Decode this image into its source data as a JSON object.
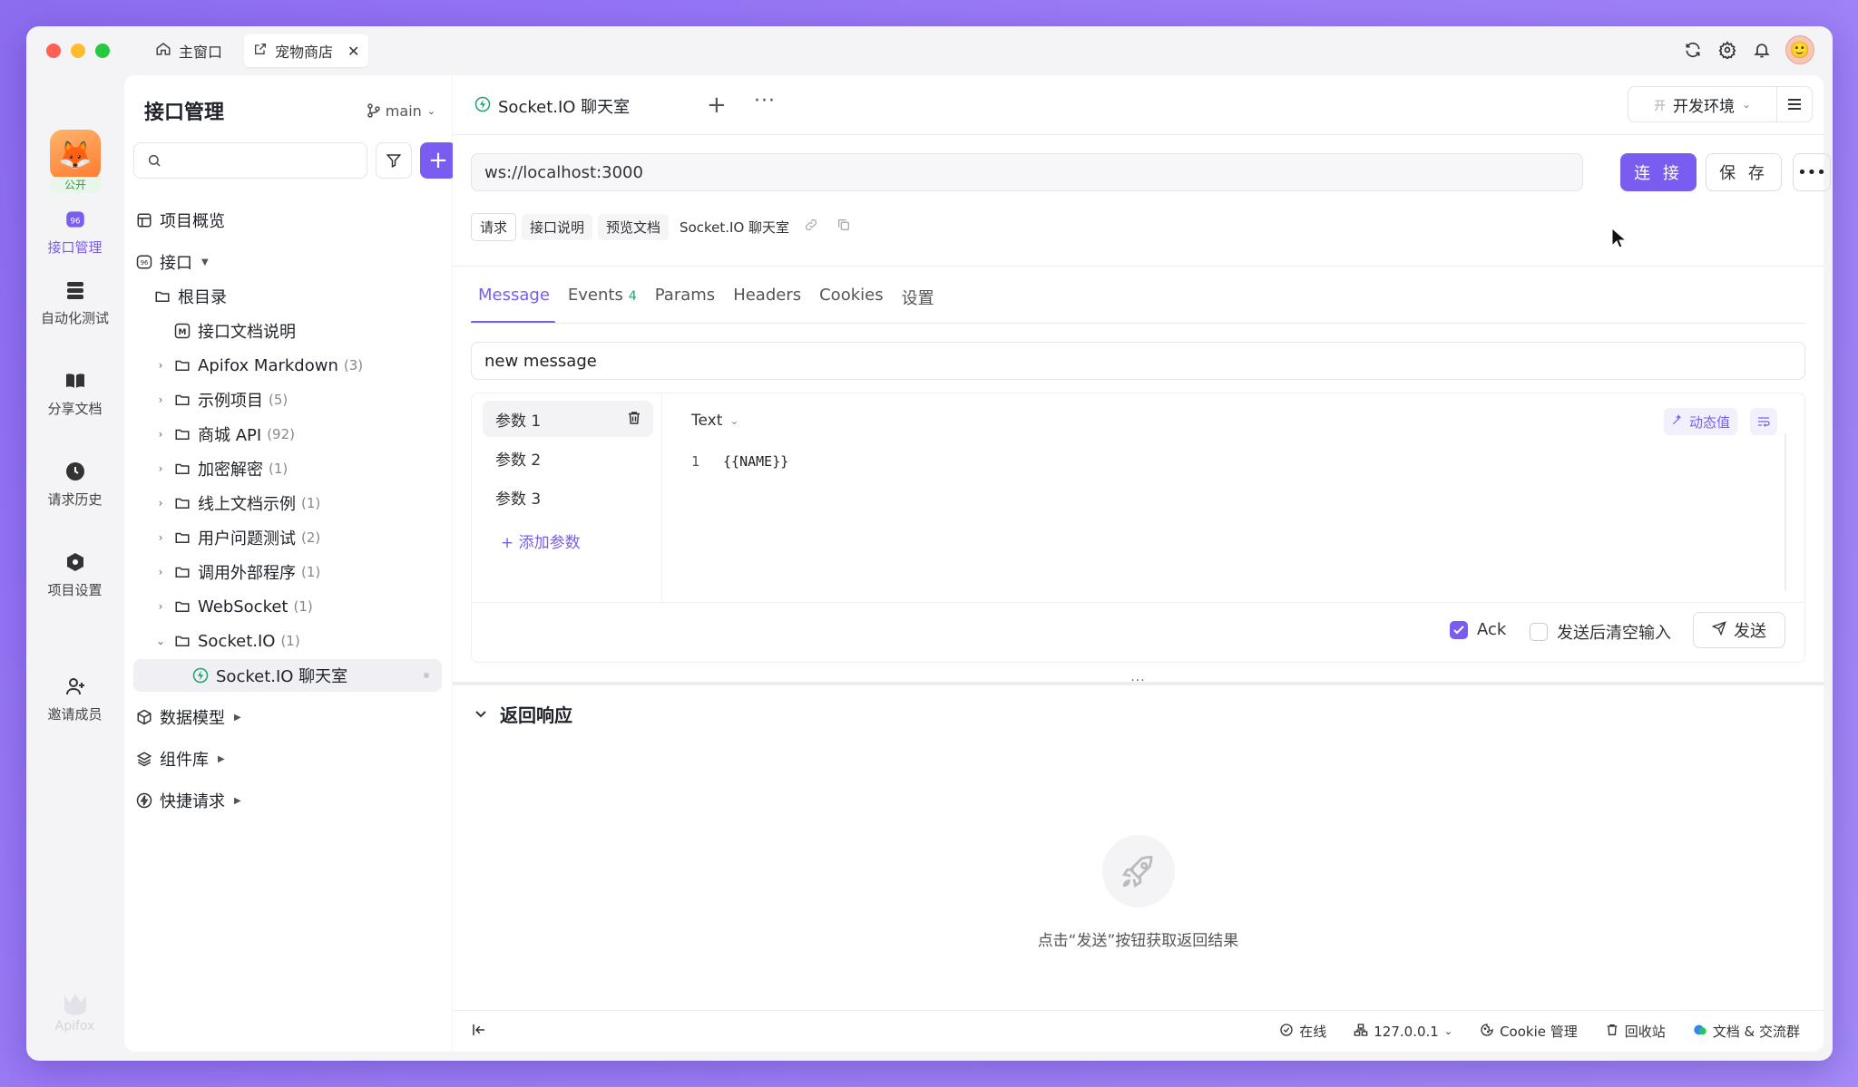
{
  "window_tabs": [
    {
      "label": "主窗口",
      "icon": "home-icon",
      "active": false
    },
    {
      "label": "宠物商店",
      "icon": "external-link-icon",
      "active": true
    }
  ],
  "title_icons": [
    "sync-icon",
    "settings-icon",
    "bell-icon"
  ],
  "rail": {
    "project_tag": "公开",
    "items": [
      {
        "label": "接口管理",
        "icon": "api-icon",
        "active": true
      },
      {
        "label": "自动化测试",
        "icon": "database-icon"
      },
      {
        "label": "分享文档",
        "icon": "book-icon"
      },
      {
        "label": "请求历史",
        "icon": "clock-icon"
      },
      {
        "label": "项目设置",
        "icon": "hexagon-settings-icon"
      },
      {
        "label": "邀请成员",
        "icon": "add-user-icon"
      }
    ],
    "brand": "Apifox"
  },
  "sidebar": {
    "title": "接口管理",
    "branch": "main",
    "search_placeholder": "",
    "overview": "项目概览",
    "api_root": "接口",
    "root_dir": "根目录",
    "doc_md": "接口文档说明",
    "folders": [
      {
        "name": "Apifox Markdown",
        "count": "(3)"
      },
      {
        "name": "示例项目",
        "count": "(5)"
      },
      {
        "name": "商城 API",
        "count": "(92)"
      },
      {
        "name": "加密解密",
        "count": "(1)"
      },
      {
        "name": "线上文档示例",
        "count": "(1)"
      },
      {
        "name": "用户问题测试",
        "count": "(2)"
      },
      {
        "name": "调用外部程序",
        "count": "(1)"
      },
      {
        "name": "WebSocket",
        "count": "(1)"
      },
      {
        "name": "Socket.IO",
        "count": "(1)"
      }
    ],
    "selected_item": "Socket.IO 聊天室",
    "sections": [
      "数据模型",
      "组件库",
      "快捷请求"
    ]
  },
  "main": {
    "doc_tab": "Socket.IO 聊天室",
    "env_badge": "开",
    "env_name": "开发环境",
    "url": "ws://localhost:3000",
    "connect_label": "连 接",
    "save_label": "保 存",
    "subtabs": [
      "请求",
      "接口说明",
      "预览文档"
    ],
    "doc_name": "Socket.IO 聊天室",
    "tabs": [
      {
        "label": "Message",
        "active": true
      },
      {
        "label": "Events",
        "badge": "4"
      },
      {
        "label": "Params"
      },
      {
        "label": "Headers"
      },
      {
        "label": "Cookies"
      },
      {
        "label": "设置"
      }
    ],
    "message_value": "new message",
    "params": [
      "参数 1",
      "参数 2",
      "参数 3"
    ],
    "add_param": "+ 添加参数",
    "editor_type": "Text",
    "dynamic_label": "动态值",
    "code_line_no": "1",
    "code_text": "{{NAME}}",
    "ack_label": "Ack",
    "ack_checked": true,
    "clear_label": "发送后清空输入",
    "clear_checked": false,
    "send_label": "发送",
    "response_title": "返回响应",
    "response_hint": "点击“发送”按钮获取返回结果"
  },
  "statusbar": {
    "online": "在线",
    "ip": "127.0.0.1",
    "cookie": "Cookie 管理",
    "trash": "回收站",
    "docs": "文档 & 交流群"
  },
  "colors": {
    "accent": "#7b5cf0",
    "success": "#22a06b"
  }
}
